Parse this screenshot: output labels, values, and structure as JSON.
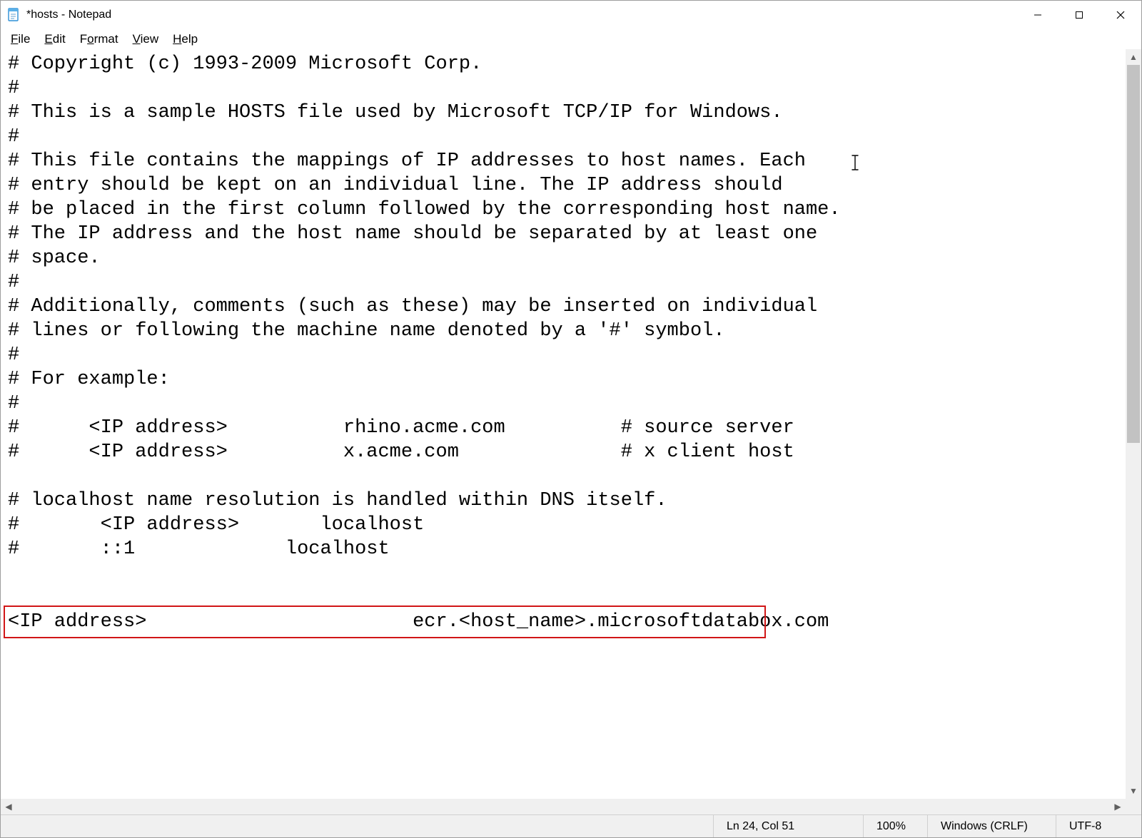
{
  "window": {
    "title": "*hosts - Notepad"
  },
  "menu": {
    "file": "File",
    "edit": "Edit",
    "format": "Format",
    "view": "View",
    "help": "Help"
  },
  "editor": {
    "lines": [
      "# Copyright (c) 1993-2009 Microsoft Corp.",
      "#",
      "# This is a sample HOSTS file used by Microsoft TCP/IP for Windows.",
      "#",
      "# This file contains the mappings of IP addresses to host names. Each",
      "# entry should be kept on an individual line. The IP address should",
      "# be placed in the first column followed by the corresponding host name.",
      "# The IP address and the host name should be separated by at least one",
      "# space.",
      "#",
      "# Additionally, comments (such as these) may be inserted on individual",
      "# lines or following the machine name denoted by a '#' symbol.",
      "#",
      "# For example:",
      "#",
      "#      <IP address>          rhino.acme.com          # source server",
      "#      <IP address>          x.acme.com              # x client host",
      "",
      "# localhost name resolution is handled within DNS itself.",
      "#       <IP address>       localhost",
      "#       ::1             localhost",
      "",
      "",
      "<IP address>                       ecr.<host_name>.microsoftdatabox.com"
    ],
    "highlight_line_index": 23
  },
  "status": {
    "position": "Ln 24, Col 51",
    "zoom": "100%",
    "line_ending": "Windows (CRLF)",
    "encoding": "UTF-8"
  }
}
